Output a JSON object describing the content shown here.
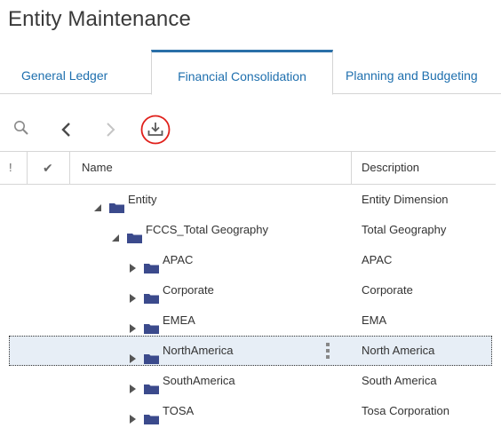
{
  "page": {
    "title": "Entity Maintenance"
  },
  "tabs": [
    {
      "label": "General Ledger",
      "active": false
    },
    {
      "label": "Financial Consolidation",
      "active": true
    },
    {
      "label": "Planning and Budgeting",
      "active": false
    }
  ],
  "toolbar": {
    "search_icon": "search-icon",
    "prev_icon": "chevron-left-icon",
    "next_icon": "chevron-right-icon",
    "export_icon": "download-icon",
    "export_highlight_color": "#e0201b"
  },
  "table": {
    "headers": {
      "flag": "!",
      "check": "✔",
      "name": "Name",
      "description": "Description"
    },
    "rows": [
      {
        "name": "Entity",
        "description": "Entity Dimension",
        "expanded": true,
        "level": 0
      },
      {
        "name": "FCCS_Total Geography",
        "description": "Total Geography",
        "expanded": true,
        "level": 1
      },
      {
        "name": "APAC",
        "description": "APAC",
        "expanded": false,
        "level": 2
      },
      {
        "name": "Corporate",
        "description": "Corporate",
        "expanded": false,
        "level": 2
      },
      {
        "name": "EMEA",
        "description": "EMA",
        "expanded": false,
        "level": 2
      },
      {
        "name": "NorthAmerica",
        "description": "North America",
        "expanded": false,
        "level": 2,
        "selected": true
      },
      {
        "name": "SouthAmerica",
        "description": "South America",
        "expanded": false,
        "level": 2
      },
      {
        "name": "TOSA",
        "description": "Tosa Corporation",
        "expanded": false,
        "level": 2
      }
    ]
  },
  "colors": {
    "accent": "#1e6fae",
    "folder": "#3b4a8c",
    "selection": "#e7eef6"
  }
}
